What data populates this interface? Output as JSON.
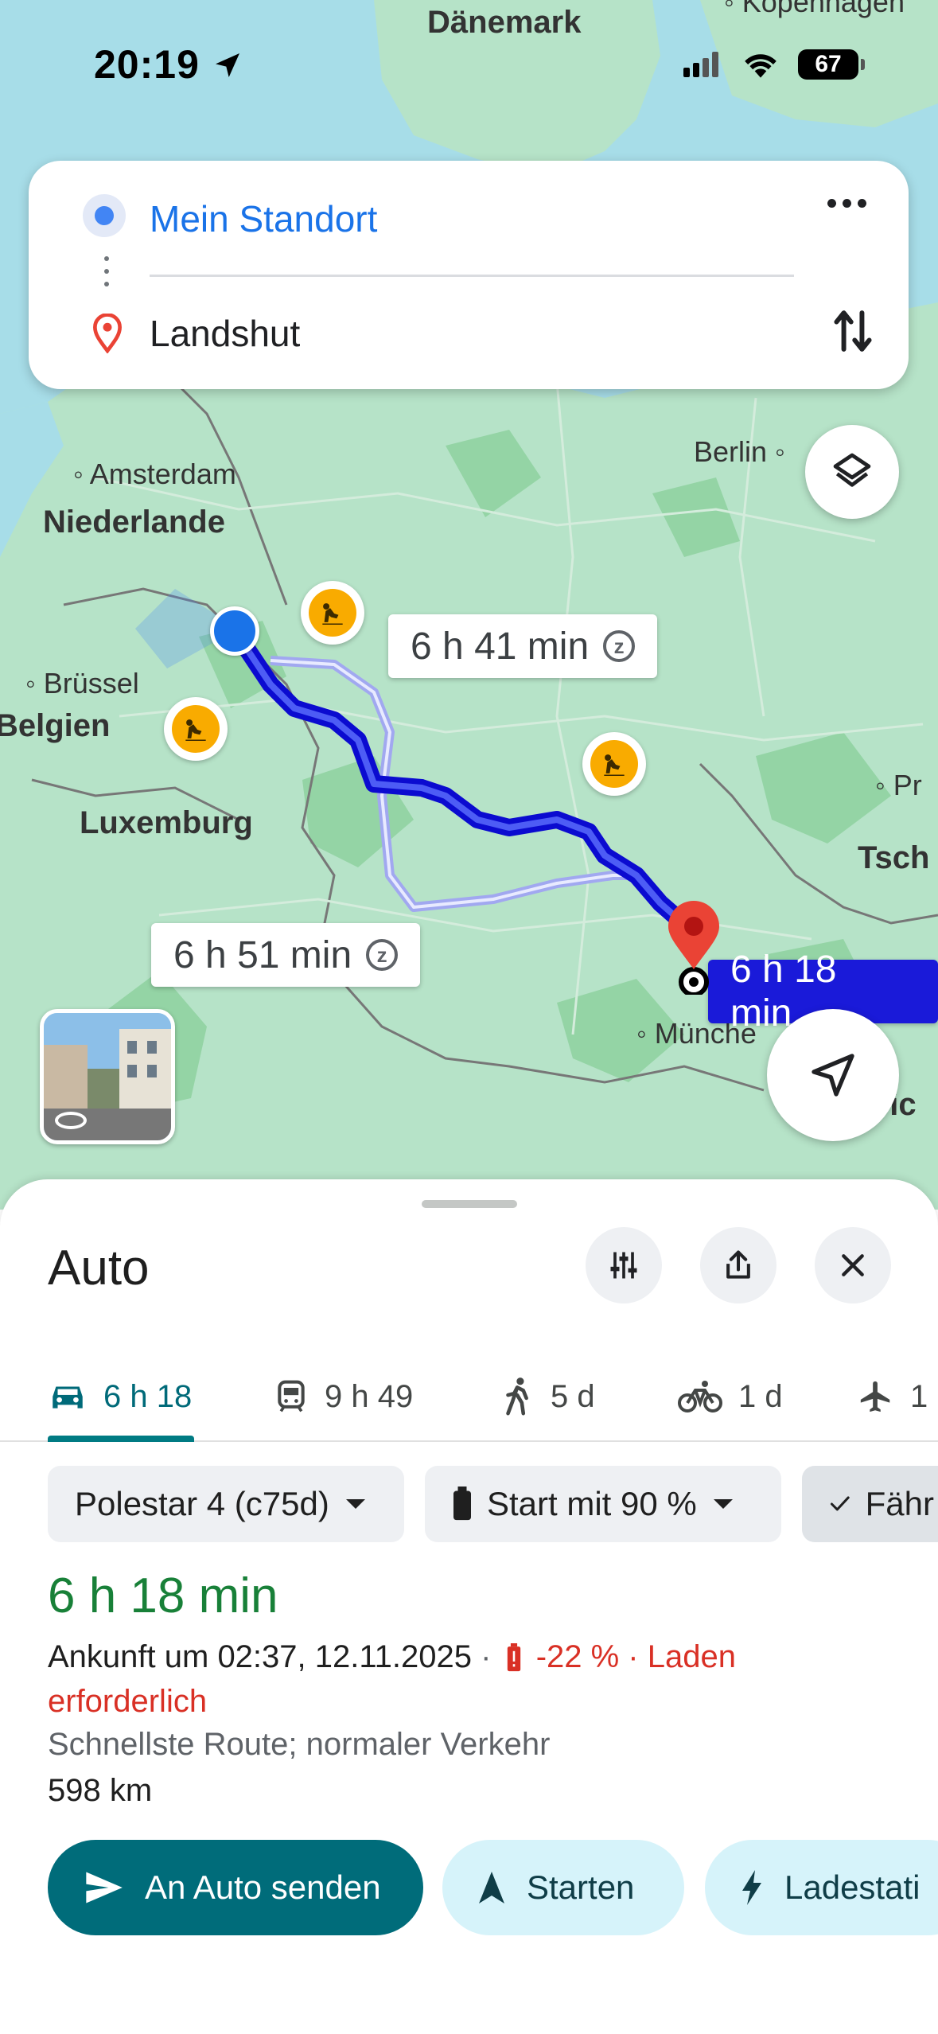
{
  "status_bar": {
    "time": "20:19",
    "battery": "67"
  },
  "search": {
    "origin": "Mein Standort",
    "destination": "Landshut"
  },
  "map": {
    "labels": {
      "daenemark": "Dänemark",
      "kopenhagen": "Kopenhagen",
      "amsterdam": "Amsterdam",
      "niederlande": "Niederlande",
      "berlin": "Berlin",
      "bruessel": "Brüssel",
      "belgien": "Belgien",
      "luxemburg": "Luxemburg",
      "prag": "Pr",
      "tschechien": "Tsch",
      "muenchen": "Münche",
      "oesterreich": "eic"
    },
    "routes": {
      "alt1": "6 h 41 min",
      "alt2": "6 h 51 min",
      "main": "6 h 18 min"
    },
    "colors": {
      "route_main": "#1a1ad9",
      "route_alt": "#a1a8f0",
      "land": "#b6e3c8",
      "water": "#a7dde8"
    }
  },
  "sheet": {
    "title": "Auto",
    "modes": [
      {
        "label": "6 h 18",
        "icon": "car-icon"
      },
      {
        "label": "9 h 49",
        "icon": "transit-icon"
      },
      {
        "label": "5 d",
        "icon": "walk-icon"
      },
      {
        "label": "1 d",
        "icon": "bike-icon"
      },
      {
        "label": "1",
        "icon": "flight-icon"
      }
    ],
    "chips": {
      "vehicle": "Polestar 4 (c75d)",
      "charge": "Start mit 90 %",
      "driver": "Fähr"
    },
    "result": {
      "duration": "6 h 18 min",
      "arrival": "Ankunft um 02:37, 12.11.2025",
      "separator": "·",
      "battery_warning": "-22 % · Laden",
      "warning_line2": "erforderlich",
      "route_desc": "Schnellste Route; normaler Verkehr",
      "distance": "598 km"
    },
    "actions": {
      "send": "An Auto senden",
      "start": "Starten",
      "charging": "Ladestati"
    }
  }
}
